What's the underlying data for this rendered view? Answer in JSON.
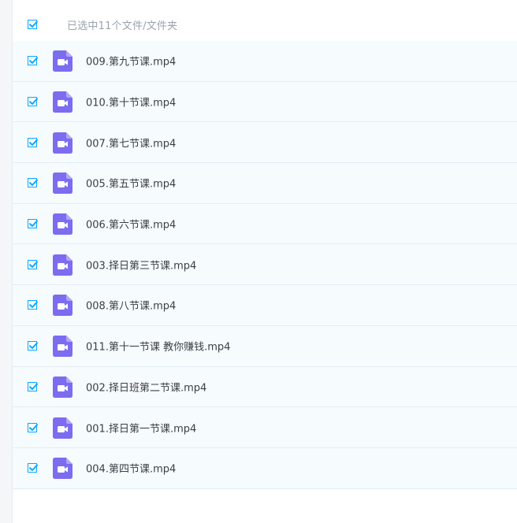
{
  "header": {
    "selection_text": "已选中11个文件/文件夹"
  },
  "files": [
    {
      "name": "009.第九节课.mp4"
    },
    {
      "name": "010.第十节课.mp4"
    },
    {
      "name": "007.第七节课.mp4"
    },
    {
      "name": "005.第五节课.mp4"
    },
    {
      "name": "006.第六节课.mp4"
    },
    {
      "name": "003.择日第三节课.mp4"
    },
    {
      "name": "008.第八节课.mp4"
    },
    {
      "name": "011.第十一节课 教你赚钱.mp4"
    },
    {
      "name": "002.择日班第二节课.mp4"
    },
    {
      "name": "001.择日第一节课.mp4"
    },
    {
      "name": "004.第四节课.mp4"
    }
  ],
  "icons": {
    "checkbox": "checkbox-checked-icon",
    "file": "video-file-icon"
  },
  "colors": {
    "accent": "#06a7ff",
    "video_icon": "#7c6cf0",
    "row_background": "#f6fbfe"
  }
}
